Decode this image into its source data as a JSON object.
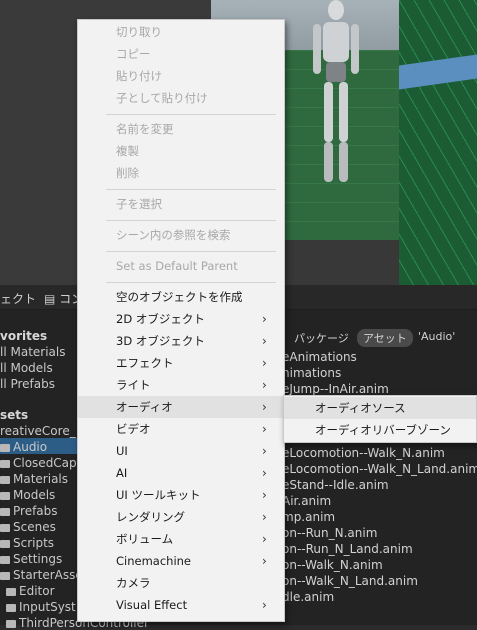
{
  "tabs": {
    "hierarchy_label": "ェクト",
    "console_label": "コン"
  },
  "sidebar": {
    "favorites_header": "vorites",
    "favorites": [
      "ll Materials",
      "ll Models",
      "ll Prefabs"
    ],
    "assets_header": "sets",
    "assets": [
      {
        "label": "reativeCore_",
        "folder": false
      },
      {
        "label": "Audio",
        "folder": true,
        "selected": true
      },
      {
        "label": "ClosedCaptic",
        "folder": true
      },
      {
        "label": "Materials",
        "folder": true
      },
      {
        "label": "Models",
        "folder": true
      },
      {
        "label": "Prefabs",
        "folder": true
      },
      {
        "label": "Scenes",
        "folder": true
      },
      {
        "label": "Scripts",
        "folder": true
      },
      {
        "label": "Settings",
        "folder": true
      },
      {
        "label": "StarterAsset",
        "folder": true
      },
      {
        "label": "Editor",
        "folder": true
      },
      {
        "label": "InputSyst",
        "folder": true
      },
      {
        "label": "ThirdPersonController",
        "folder": true
      }
    ]
  },
  "search_filter": {
    "package": "パッケージ",
    "assets": "アセット",
    "query": "'Audio'"
  },
  "files": [
    "eAnimations",
    "nimations",
    "eJump--InAir.anim",
    "eLocomotion--Walk_N.anim",
    "eLocomotion--Walk_N_Land.anim",
    "eStand--Idle.anim",
    "Air.anim",
    "mp.anim",
    "on--Run_N.anim",
    "on--Run_N_Land.anim",
    "on--Walk_N.anim",
    "on--Walk_N_Land.anim",
    "dle.anim"
  ],
  "context_menu": {
    "cut": "切り取り",
    "copy": "コピー",
    "paste": "貼り付け",
    "paste_as_child": "子として貼り付け",
    "rename": "名前を変更",
    "duplicate": "複製",
    "delete": "削除",
    "select_children": "子を選択",
    "find_references": "シーン内の参照を検索",
    "set_default_parent": "Set as Default Parent",
    "create_empty": "空のオブジェクトを作成",
    "object_2d": "2D オブジェクト",
    "object_3d": "3D オブジェクト",
    "effects": "エフェクト",
    "light": "ライト",
    "audio": "オーディオ",
    "video": "ビデオ",
    "ui": "UI",
    "ai": "AI",
    "ui_toolkit": "UI ツールキット",
    "rendering": "レンダリング",
    "volume": "ボリューム",
    "cinemachine": "Cinemachine",
    "camera": "カメラ",
    "visual_effect": "Visual Effect"
  },
  "audio_submenu": {
    "audio_source": "オーディオソース",
    "reverb_zone": "オーディオリバーブゾーン"
  }
}
